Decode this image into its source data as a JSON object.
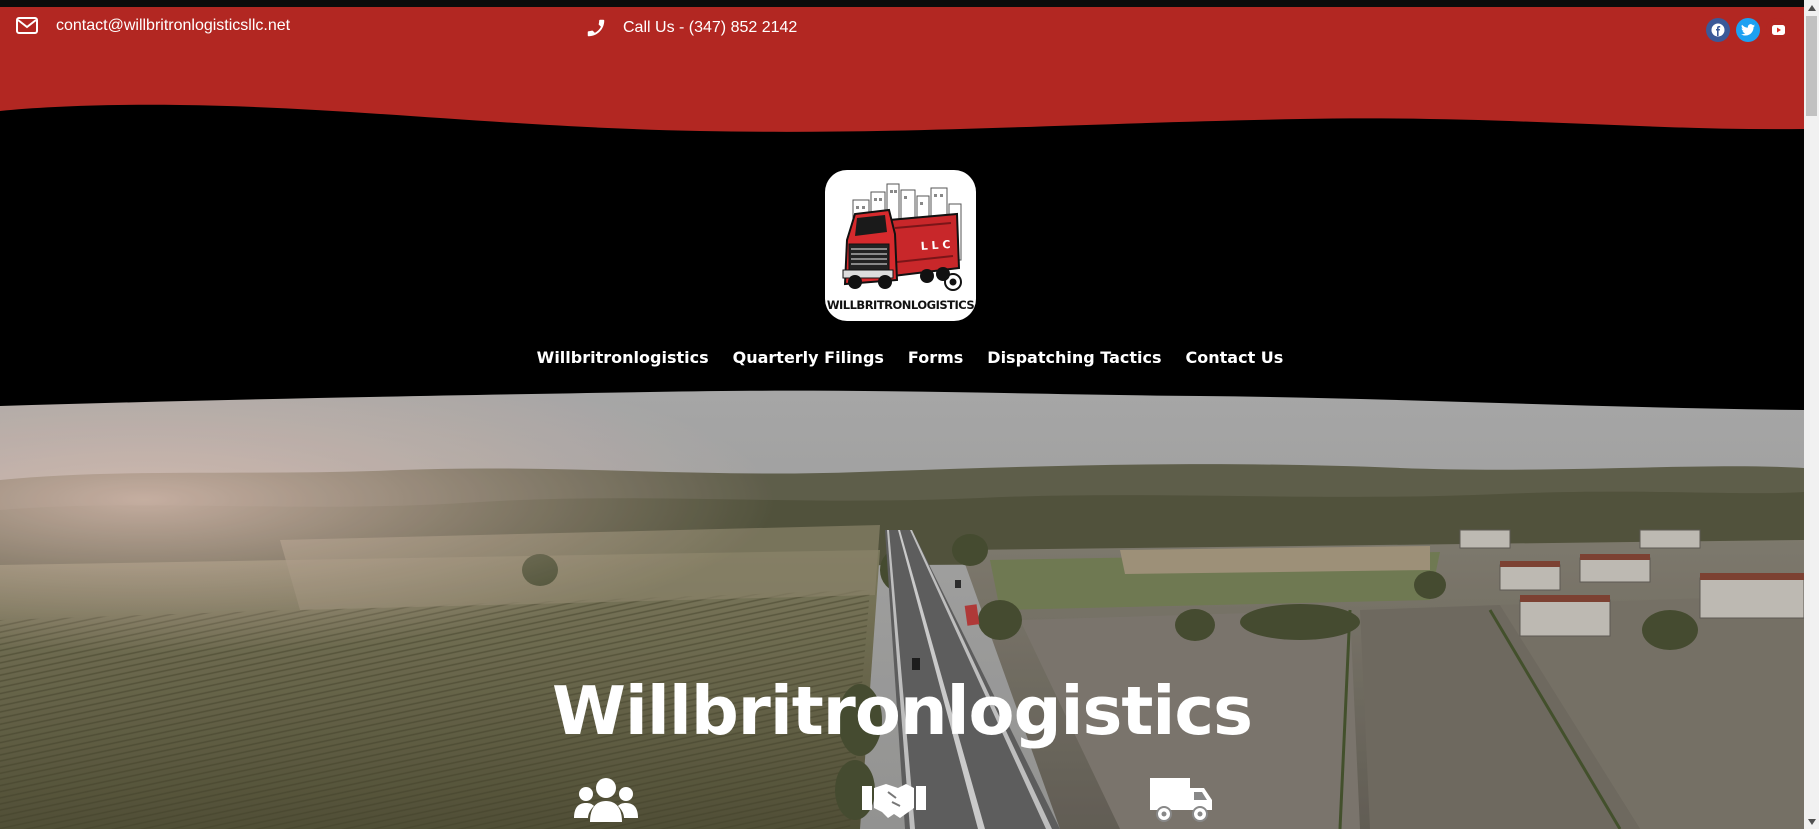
{
  "topbar": {
    "email": "contact@willbritronlogisticsllc.net",
    "phone": "Call Us - (347) 852 2142",
    "social": [
      {
        "name": "facebook",
        "glyph": "f",
        "color": "#3b5998"
      },
      {
        "name": "twitter",
        "glyph": "t",
        "color": "#1da1f2"
      },
      {
        "name": "youtube",
        "glyph": "▶",
        "color": "#e02a20"
      }
    ],
    "accent": "#b22722"
  },
  "header": {
    "logo_text": "WILLBRITRONLOGISTICS",
    "nav": [
      "Willbritronlogistics",
      "Quarterly Filings",
      "Forms",
      "Dispatching Tactics",
      "Contact Us"
    ]
  },
  "hero": {
    "title": "Willbritronlogistics",
    "icons": [
      "users-icon",
      "handshake-icon",
      "truck-icon"
    ]
  }
}
